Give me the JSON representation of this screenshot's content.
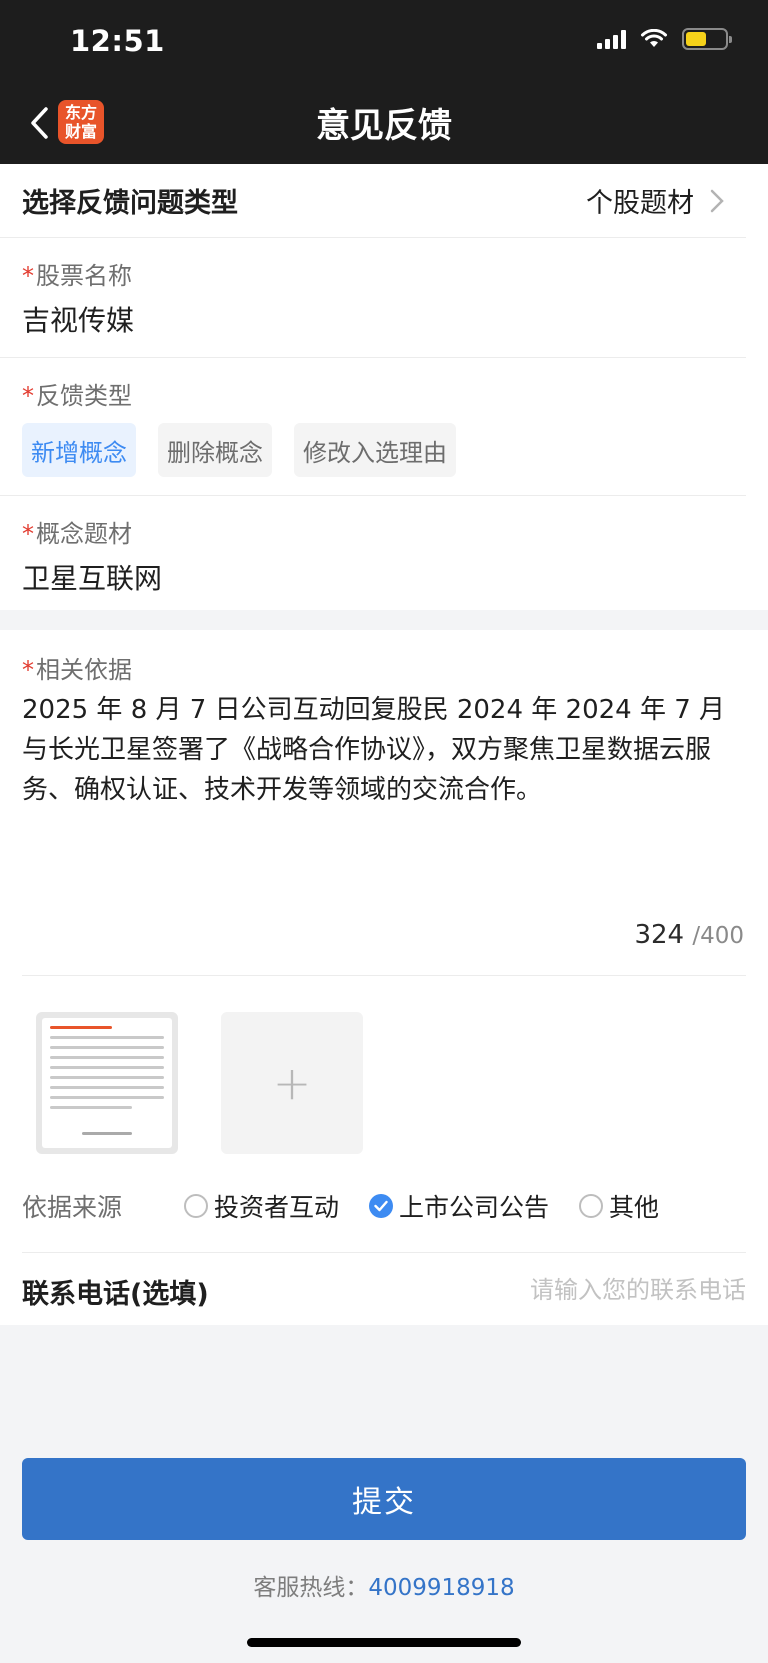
{
  "status_bar": {
    "time": "12:51"
  },
  "nav": {
    "title": "意见反馈",
    "logo_text": "东方财富"
  },
  "feedback_type": {
    "label": "选择反馈问题类型",
    "value": "个股题材"
  },
  "stock_name": {
    "label": "股票名称",
    "value": "吉视传媒"
  },
  "category": {
    "label": "反馈类型",
    "options": [
      "新增概念",
      "删除概念",
      "修改入选理由"
    ],
    "selected_index": 0
  },
  "concept": {
    "label": "概念题材",
    "value": "卫星互联网"
  },
  "basis": {
    "label": "相关依据",
    "text": "2025 年 8 月 7 日公司互动回复股民 2024 年 2024 年 7 月与长光卫星签署了《战略合作协议》，双方聚焦卫星数据云服务、确权认证、技术开发等领域的交流合作。",
    "count": "324",
    "max": "/400"
  },
  "source": {
    "label": "依据来源",
    "options": [
      "投资者互动",
      "上市公司公告",
      "其他"
    ],
    "selected_index": 1
  },
  "phone": {
    "label": "联系电话(选填)",
    "placeholder": "请输入您的联系电话"
  },
  "submit_label": "提交",
  "hotline": {
    "label": "客服热线：",
    "number": "4009918918"
  },
  "colors": {
    "accent": "#3474c8",
    "required": "#e23b2f",
    "chip_active_text": "#3d8bf2"
  }
}
